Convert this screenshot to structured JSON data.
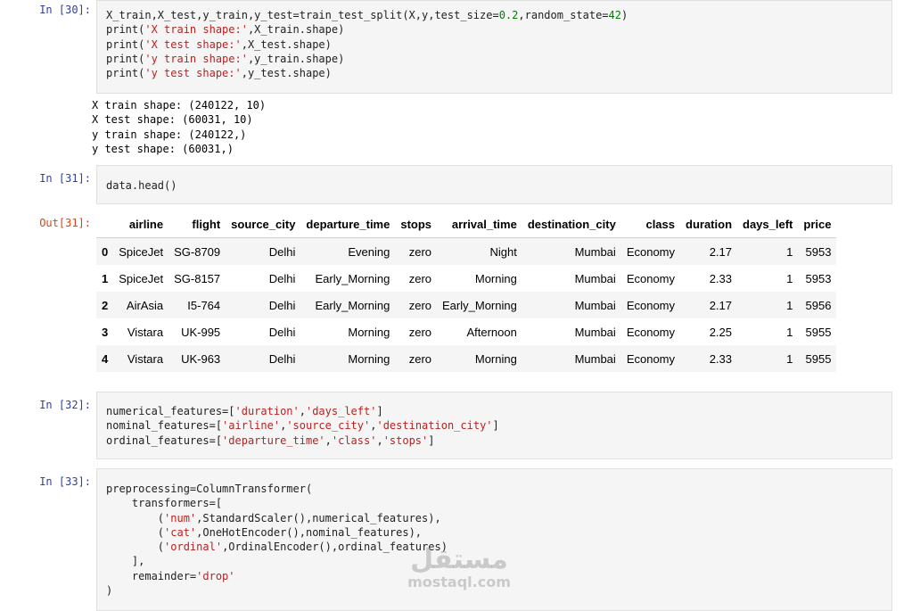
{
  "cells": {
    "c30": {
      "prompt": "In [30]:",
      "stdout": "X train shape: (240122, 10)\nX test shape: (60031, 10)\ny train shape: (240122,)\ny test shape: (60031,)"
    },
    "c31": {
      "prompt": "In [31]:",
      "code": "data.head()",
      "out_prompt": "Out[31]:"
    },
    "c32": {
      "prompt": "In [32]:"
    },
    "c33": {
      "prompt": "In [33]:"
    }
  },
  "dataframe": {
    "columns": [
      "airline",
      "flight",
      "source_city",
      "departure_time",
      "stops",
      "arrival_time",
      "destination_city",
      "class",
      "duration",
      "days_left",
      "price"
    ],
    "rows": [
      [
        "0",
        "SpiceJet",
        "SG-8709",
        "Delhi",
        "Evening",
        "zero",
        "Night",
        "Mumbai",
        "Economy",
        "2.17",
        "1",
        "5953"
      ],
      [
        "1",
        "SpiceJet",
        "SG-8157",
        "Delhi",
        "Early_Morning",
        "zero",
        "Morning",
        "Mumbai",
        "Economy",
        "2.33",
        "1",
        "5953"
      ],
      [
        "2",
        "AirAsia",
        "I5-764",
        "Delhi",
        "Early_Morning",
        "zero",
        "Early_Morning",
        "Mumbai",
        "Economy",
        "2.17",
        "1",
        "5956"
      ],
      [
        "3",
        "Vistara",
        "UK-995",
        "Delhi",
        "Morning",
        "zero",
        "Afternoon",
        "Mumbai",
        "Economy",
        "2.25",
        "1",
        "5955"
      ],
      [
        "4",
        "Vistara",
        "UK-963",
        "Delhi",
        "Morning",
        "zero",
        "Morning",
        "Mumbai",
        "Economy",
        "2.33",
        "1",
        "5955"
      ]
    ]
  },
  "code_tokens": {
    "c30": {
      "l1_a": "X_train,X_test,y_train,y_test=train_test_split(X,y,test_size=",
      "l1_n1": "0.2",
      "l1_b": ",random_state=",
      "l1_n2": "42",
      "l1_c": ")",
      "p": "print(",
      "s1": "'X train shape:'",
      "r1": ",X_train.shape)",
      "s2": "'X test shape:'",
      "r2": ",X_test.shape)",
      "s3": "'y train shape:'",
      "r3": ",y_train.shape)",
      "s4": "'y test shape:'",
      "r4": ",y_test.shape)"
    },
    "c32": {
      "a1": "numerical_features=[",
      "a1s1": "'duration'",
      "a1s2": "'days_left'",
      "a2": "nominal_features=[",
      "a2s1": "'airline'",
      "a2s2": "'source_city'",
      "a2s3": "'destination_city'",
      "a3": "ordinal_features=[",
      "a3s1": "'departure_time'",
      "a3s2": "'class'",
      "a3s3": "'stops'",
      "comma": ",",
      "close": "]"
    },
    "c33": {
      "l1": "preprocessing=ColumnTransformer(",
      "l2": "    transformers=[",
      "t1o": "        (",
      "t1s": "'num'",
      "t1r": ",StandardScaler(),numerical_features),",
      "t2o": "        (",
      "t2s": "'cat'",
      "t2r": ",OneHotEncoder(),nominal_features),",
      "t3o": "        (",
      "t3s": "'ordinal'",
      "t3r": ",OrdinalEncoder(),ordinal_features)",
      "l6": "    ],",
      "l7a": "    remainder=",
      "l7s": "'drop'",
      "l8": ")"
    }
  },
  "watermark": {
    "arabic": "مستقل",
    "latin": "mostaql.com"
  }
}
